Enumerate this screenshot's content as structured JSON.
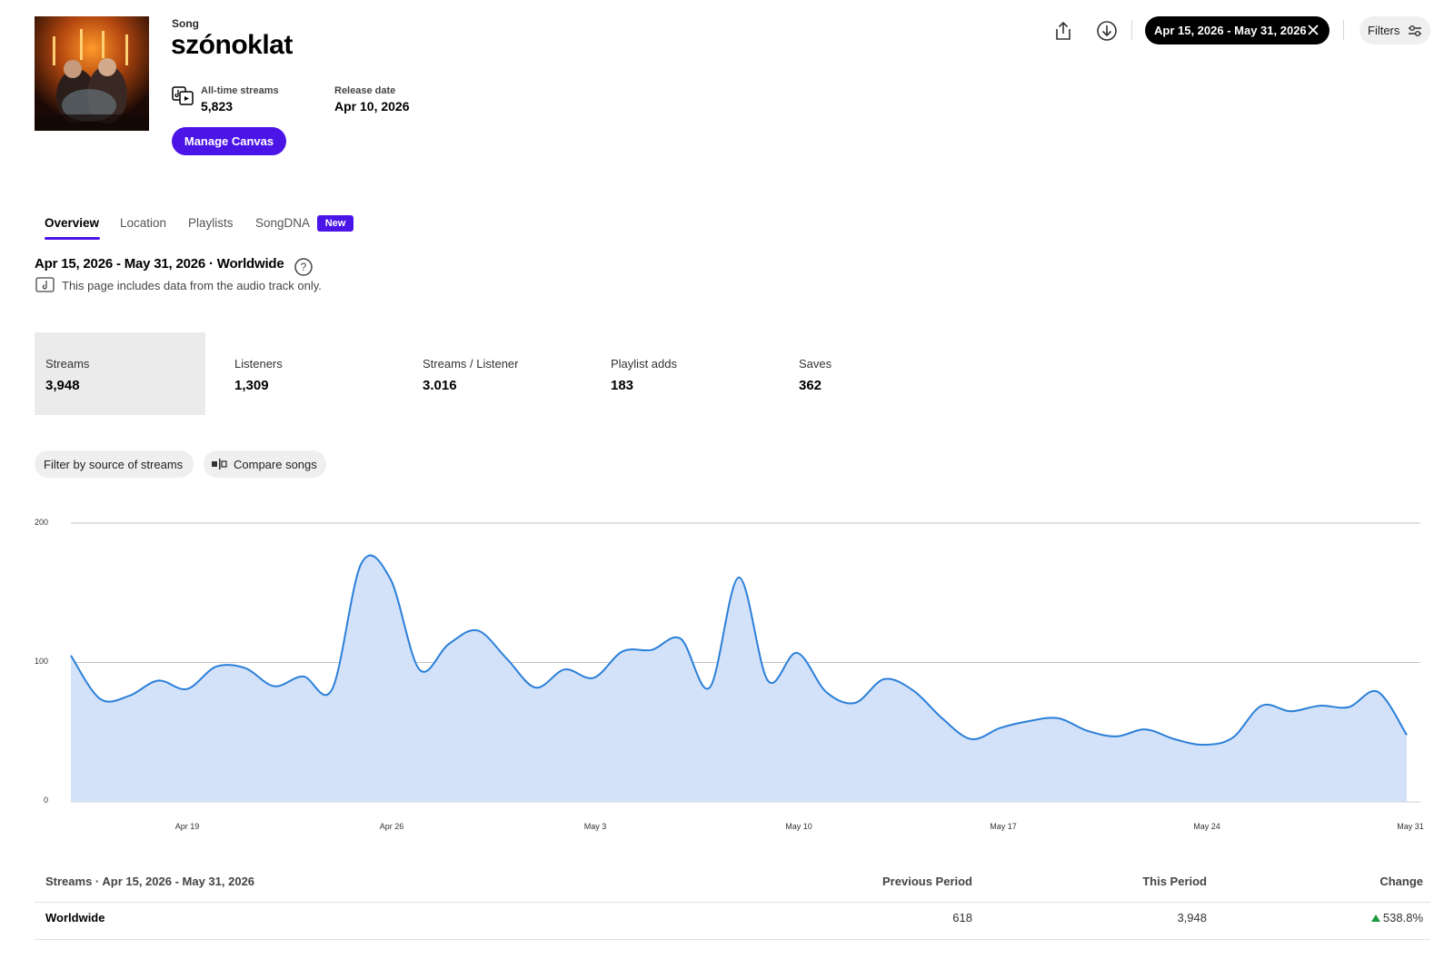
{
  "song": {
    "kind_label": "Song",
    "title": "szónoklat",
    "all_time_streams_label": "All-time streams",
    "all_time_streams": "5,823",
    "release_date_label": "Release date",
    "release_date": "Apr 10, 2026",
    "manage_canvas_label": "Manage Canvas"
  },
  "toolbar": {
    "date_range": "Apr 15, 2026 - May 31, 2026",
    "filters_label": "Filters"
  },
  "tabs": [
    {
      "label": "Overview",
      "active": true
    },
    {
      "label": "Location",
      "active": false
    },
    {
      "label": "Playlists",
      "active": false
    },
    {
      "label": "SongDNA",
      "active": false,
      "badge": "New"
    }
  ],
  "context": {
    "title": "Apr 15, 2026 - May 31, 2026 · Worldwide",
    "note": "This page includes data from the audio track only."
  },
  "metrics": [
    {
      "label": "Streams",
      "value": "3,948",
      "active": true
    },
    {
      "label": "Listeners",
      "value": "1,309",
      "active": false
    },
    {
      "label": "Streams / Listener",
      "value": "3.016",
      "active": false
    },
    {
      "label": "Playlist adds",
      "value": "183",
      "active": false
    },
    {
      "label": "Saves",
      "value": "362",
      "active": false
    }
  ],
  "chips": {
    "filter_label": "Filter by source of streams",
    "compare_label": "Compare songs"
  },
  "chart_data": {
    "type": "area",
    "x_start": "Apr 15, 2026",
    "x_end": "May 31, 2026",
    "x_tick_labels": [
      "Apr 19",
      "Apr 26",
      "May 3",
      "May 10",
      "May 17",
      "May 24",
      "May 31"
    ],
    "y_tick_labels": [
      "200",
      "100",
      "0"
    ],
    "ylim": [
      0,
      200
    ],
    "grid": true,
    "color": "#2b7fd8",
    "fill": "#d3e2f9",
    "x": [
      "Apr 15",
      "Apr 16",
      "Apr 17",
      "Apr 18",
      "Apr 19",
      "Apr 20",
      "Apr 21",
      "Apr 22",
      "Apr 23",
      "Apr 24",
      "Apr 25",
      "Apr 26",
      "Apr 27",
      "Apr 28",
      "Apr 29",
      "Apr 30",
      "May 1",
      "May 2",
      "May 3",
      "May 4",
      "May 5",
      "May 6",
      "May 7",
      "May 8",
      "May 9",
      "May 10",
      "May 11",
      "May 12",
      "May 13",
      "May 14",
      "May 15",
      "May 16",
      "May 17",
      "May 18",
      "May 19",
      "May 20",
      "May 21",
      "May 22",
      "May 23",
      "May 24",
      "May 25",
      "May 26",
      "May 27",
      "May 28",
      "May 29",
      "May 30",
      "May 31"
    ],
    "values": [
      105,
      74,
      76,
      87,
      81,
      97,
      96,
      83,
      90,
      81,
      171,
      160,
      95,
      113,
      123,
      103,
      82,
      95,
      89,
      108,
      109,
      117,
      82,
      161,
      87,
      107,
      79,
      71,
      88,
      80,
      60,
      45,
      53,
      58,
      60,
      51,
      47,
      52,
      45,
      41,
      46,
      69,
      65,
      69,
      68,
      79,
      48
    ]
  },
  "table": {
    "title": "Streams · Apr 15, 2026 - May 31, 2026",
    "col_previous": "Previous Period",
    "col_this": "This Period",
    "col_change": "Change",
    "rows": [
      {
        "region": "Worldwide",
        "previous": "618",
        "this": "3,948",
        "change": "538.8%",
        "change_direction": "up",
        "change_color": "#1a9a3e"
      }
    ]
  }
}
